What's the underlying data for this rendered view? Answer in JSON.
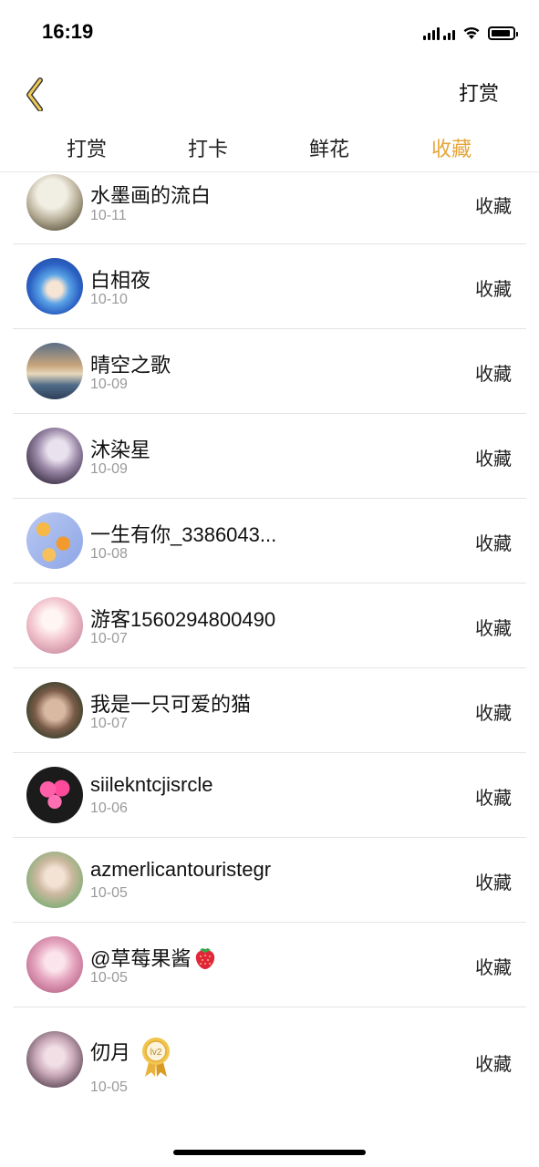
{
  "status_bar": {
    "time": "16:19",
    "icons": [
      "signal-icon",
      "wifi-icon",
      "battery-icon"
    ]
  },
  "nav": {
    "back_icon": "chevron-left-icon",
    "right_label": "打赏"
  },
  "tabs": [
    {
      "label": "打赏",
      "active": false
    },
    {
      "label": "打卡",
      "active": false
    },
    {
      "label": "鲜花",
      "active": false
    },
    {
      "label": "收藏",
      "active": true
    }
  ],
  "colors": {
    "accent": "#e6a53a",
    "text": "#111111",
    "muted": "#9a9a9a",
    "divider": "#e4e4e4"
  },
  "list": [
    {
      "name": "水墨画的流白",
      "date": "10-11",
      "action": "收藏"
    },
    {
      "name": "白相夜",
      "date": "10-10",
      "action": "收藏"
    },
    {
      "name": "晴空之歌",
      "date": "10-09",
      "action": "收藏"
    },
    {
      "name": "沐染星",
      "date": "10-09",
      "action": "收藏"
    },
    {
      "name": "一生有你_3386043...",
      "date": "10-08",
      "action": "收藏"
    },
    {
      "name": "游客1560294800490",
      "date": "10-07",
      "action": "收藏"
    },
    {
      "name": "我是一只可爱的猫",
      "date": "10-07",
      "action": "收藏"
    },
    {
      "name": "siilekntcjisrcle",
      "date": "10-06",
      "action": "收藏"
    },
    {
      "name": "azmerlicantouristegr",
      "date": "10-05",
      "action": "收藏"
    },
    {
      "name": "@草莓果酱",
      "date": "10-05",
      "action": "收藏",
      "emoji": "strawberry-icon"
    },
    {
      "name": "仞月",
      "date": "10-05",
      "action": "收藏",
      "badge": "lv2",
      "badge_icon": "level-medal-icon"
    }
  ]
}
